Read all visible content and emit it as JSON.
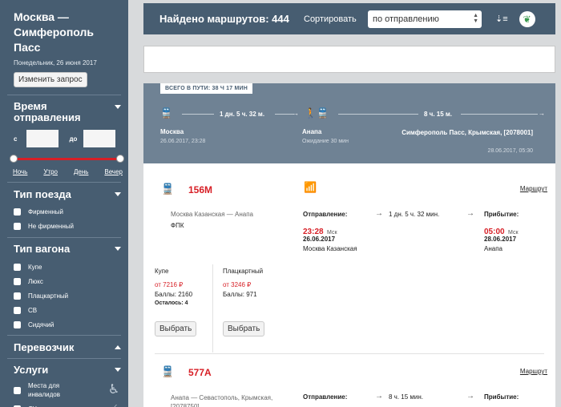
{
  "sidebar": {
    "route_title": "Москва — Симферополь Пасс",
    "route_date": "Понедельник, 26 июня 2017",
    "change_button": "Изменить запрос",
    "departure_time": {
      "title": "Время отправления",
      "from_label": "с",
      "to_label": "до",
      "periods": [
        "Ночь",
        "Утро",
        "День",
        "Вечер"
      ]
    },
    "train_type": {
      "title": "Тип поезда",
      "options": [
        "Фирменный",
        "Не фирменный"
      ]
    },
    "car_type": {
      "title": "Тип вагона",
      "options": [
        "Купе",
        "Люкс",
        "Плацкартный",
        "СВ",
        "Сидячий"
      ]
    },
    "carrier": {
      "title": "Перевозчик"
    },
    "services": {
      "title": "Услуги",
      "options": [
        "Места для инвалидов",
        "ЛЦ"
      ]
    }
  },
  "topbar": {
    "found": "Найдено маршрутов: 444",
    "sort_label": "Сортировать",
    "sort_value": "по отправлению",
    "sort_icon": "sort-desc-icon",
    "eco_icon": "leaf-icon"
  },
  "search": {
    "value": ""
  },
  "route": {
    "total_label": "ВСЕГО В ПУТИ: 38 Ч 17 МИН",
    "seg1_duration": "1 дн. 5 ч. 32 м.",
    "seg2_duration": "8 ч. 15 м.",
    "from_station": "Москва",
    "from_datetime": "26.06.2017, 23:28",
    "mid_station": "Анапа",
    "mid_wait": "Ожидание 30 мин",
    "to_station": "Симферополь Пасс, Крымская, [2078001]",
    "to_datetime": "28.06.2017, 05:30"
  },
  "trains": [
    {
      "number": "156М",
      "route": "Москва Казанская — Анапа",
      "company": "ФПК",
      "route_link": "Маршрут",
      "departure_label": "Отправление:",
      "departure_time": "23:28",
      "departure_tz": "Мск",
      "departure_date": "26.06.2017",
      "departure_station": "Москва Казанская",
      "duration": "1 дн. 5 ч. 32 мин.",
      "arrival_label": "Прибытие:",
      "arrival_time": "05:00",
      "arrival_tz": "Мск",
      "arrival_date": "28.06.2017",
      "arrival_station": "Анапа",
      "fares": [
        {
          "class": "Купе",
          "price": "от 7216 ₽",
          "points": "Баллы: 2160",
          "left": "Осталось: 4",
          "button": "Выбрать"
        },
        {
          "class": "Плацкартный",
          "price": "от 3246 ₽",
          "points": "Баллы: 971",
          "left": "",
          "button": "Выбрать"
        }
      ]
    },
    {
      "number": "577А",
      "route": "Анапа — Севастополь, Крымская, [2078750]",
      "route_link": "Маршрут",
      "departure_label": "Отправление:",
      "duration": "8 ч. 15 мин.",
      "arrival_label": "Прибытие:"
    }
  ]
}
